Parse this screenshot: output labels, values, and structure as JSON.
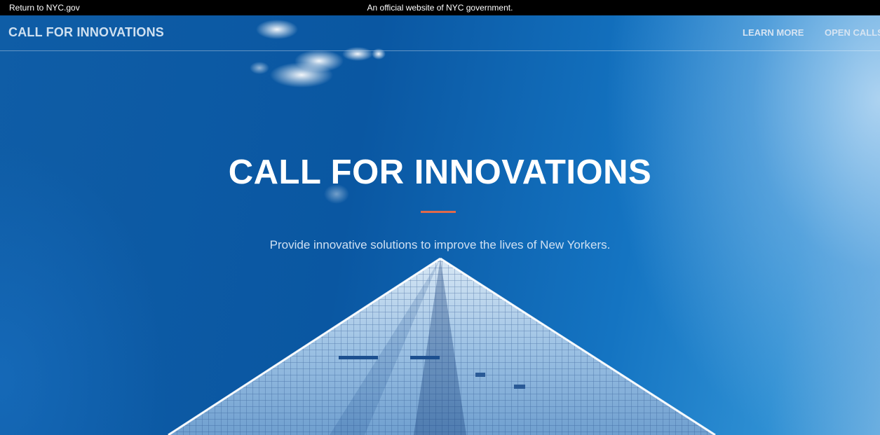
{
  "gov_bar": {
    "return_link": "Return to NYC.gov",
    "official_notice": "An official website of NYC government."
  },
  "navbar": {
    "brand": "CALL FOR INNOVATIONS",
    "links": [
      {
        "label": "LEARN MORE"
      },
      {
        "label": "OPEN CALLS"
      }
    ]
  },
  "hero": {
    "title": "CALL FOR INNOVATIONS",
    "subtitle": "Provide innovative solutions to improve the lives of New Yorkers."
  },
  "colors": {
    "accent_rule": "#e06a4a",
    "sky_blue": "#0a57a2",
    "gov_bar": "#000000"
  }
}
